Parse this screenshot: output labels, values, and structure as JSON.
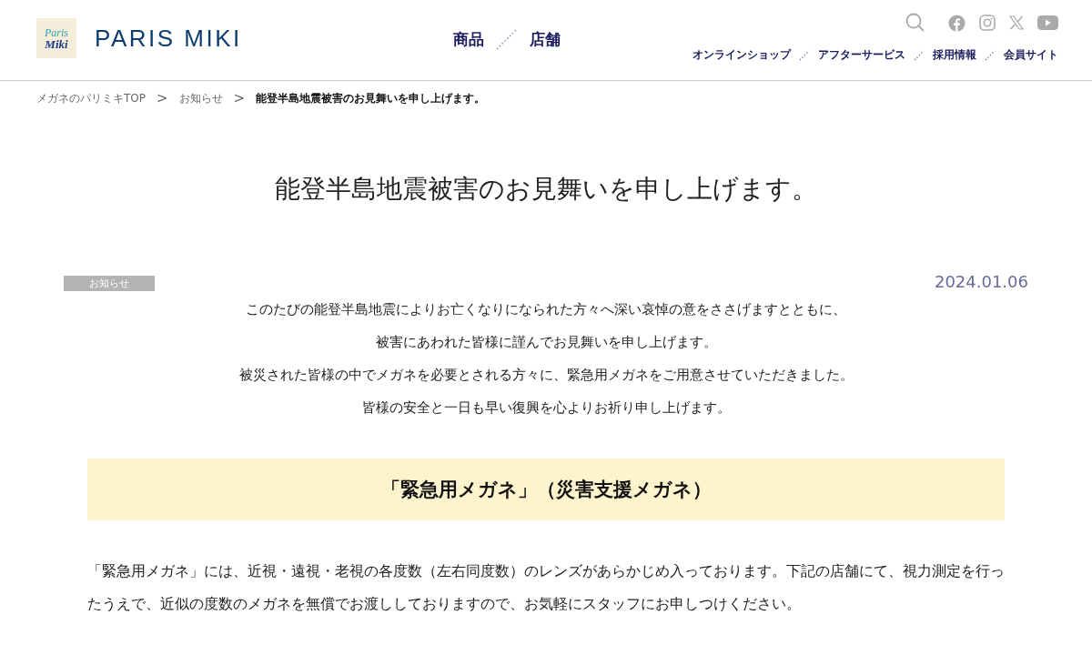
{
  "header": {
    "logo_mark": [
      "Paris",
      "Miki"
    ],
    "logo_text": "PARIS MIKI",
    "main_nav": [
      "商品",
      "店舗"
    ],
    "sub_nav": [
      "オンラインショップ",
      "アフターサービス",
      "採用情報",
      "会員サイト"
    ]
  },
  "breadcrumb": [
    {
      "label": "メガネのパリミキTOP",
      "current": false
    },
    {
      "label": "お知らせ",
      "current": false
    },
    {
      "label": "能登半島地震被害のお見舞いを申し上げます。",
      "current": true
    }
  ],
  "breadcrumb_separator": ">",
  "article": {
    "title": "能登半島地震被害のお見舞いを申し上げます。",
    "category": "お知らせ",
    "date": "2024.01.06",
    "lead": [
      "このたびの能登半島地震によりお亡くなりになられた方々へ深い哀悼の意をささげますとともに、",
      "被害にあわれた皆様に謹んでお見舞いを申し上げます。",
      "被災された皆様の中でメガネを必要とされる方々に、緊急用メガネをご用意させていただきました。",
      "皆様の安全と一日も早い復興を心よりお祈り申し上げます。"
    ],
    "section_heading": "「緊急用メガネ」（災害支援メガネ）",
    "body": "「緊急用メガネ」には、近視・遠視・老視の各度数（左右同度数）のレンズがあらかじめ入っております。下記の店舗にて、視力測定を行ったうえで、近似の度数のメガネを無償でお渡ししておりますので、お気軽にスタッフにお申しつけください。"
  }
}
